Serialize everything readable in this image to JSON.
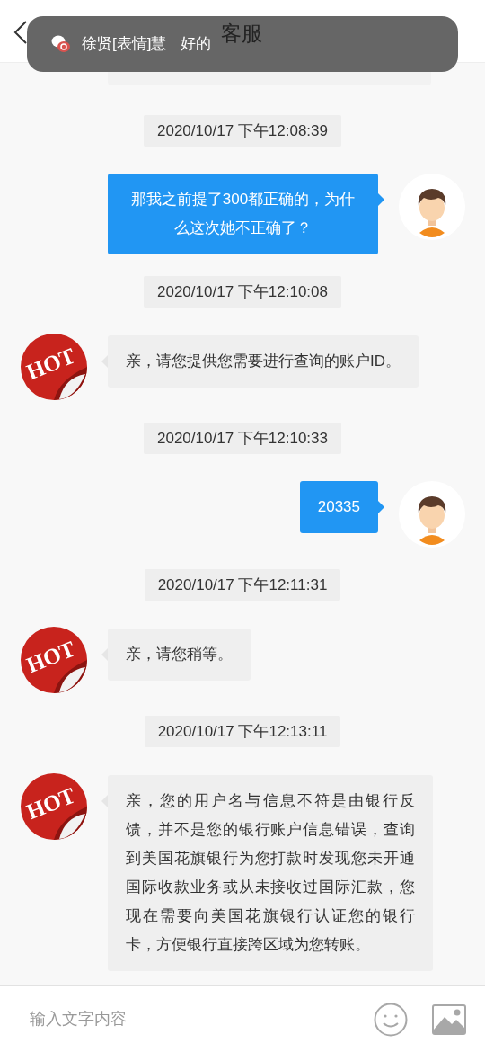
{
  "header": {
    "title": "客服"
  },
  "notification": {
    "sender": "徐贤[表情]慧",
    "message": "好的"
  },
  "chat": [
    {
      "kind": "time",
      "text": "2020/10/17 下午12:08:39"
    },
    {
      "kind": "sent",
      "text": "那我之前提了300都正确的，为什么这次她不正确了？"
    },
    {
      "kind": "time",
      "text": "2020/10/17 下午12:10:08"
    },
    {
      "kind": "received",
      "badge": "HOT",
      "text": "亲，请您提供您需要进行查询的账户ID。"
    },
    {
      "kind": "time",
      "text": "2020/10/17 下午12:10:33"
    },
    {
      "kind": "sent",
      "text": "20335"
    },
    {
      "kind": "time",
      "text": "2020/10/17 下午12:11:31"
    },
    {
      "kind": "received",
      "badge": "HOT",
      "text": "亲，请您稍等。"
    },
    {
      "kind": "time",
      "text": "2020/10/17 下午12:13:11"
    },
    {
      "kind": "received",
      "badge": "HOT",
      "text": "亲，您的用户名与信息不符是由银行反馈，并不是您的银行账户信息错误，查询到美国花旗银行为您打款时发现您未开通国际收款业务或从未接收过国际汇款，您现在需要向美国花旗银行认证您的银行卡，方便银行直接跨区域为您转账。"
    }
  ],
  "input": {
    "placeholder": "输入文字内容"
  }
}
